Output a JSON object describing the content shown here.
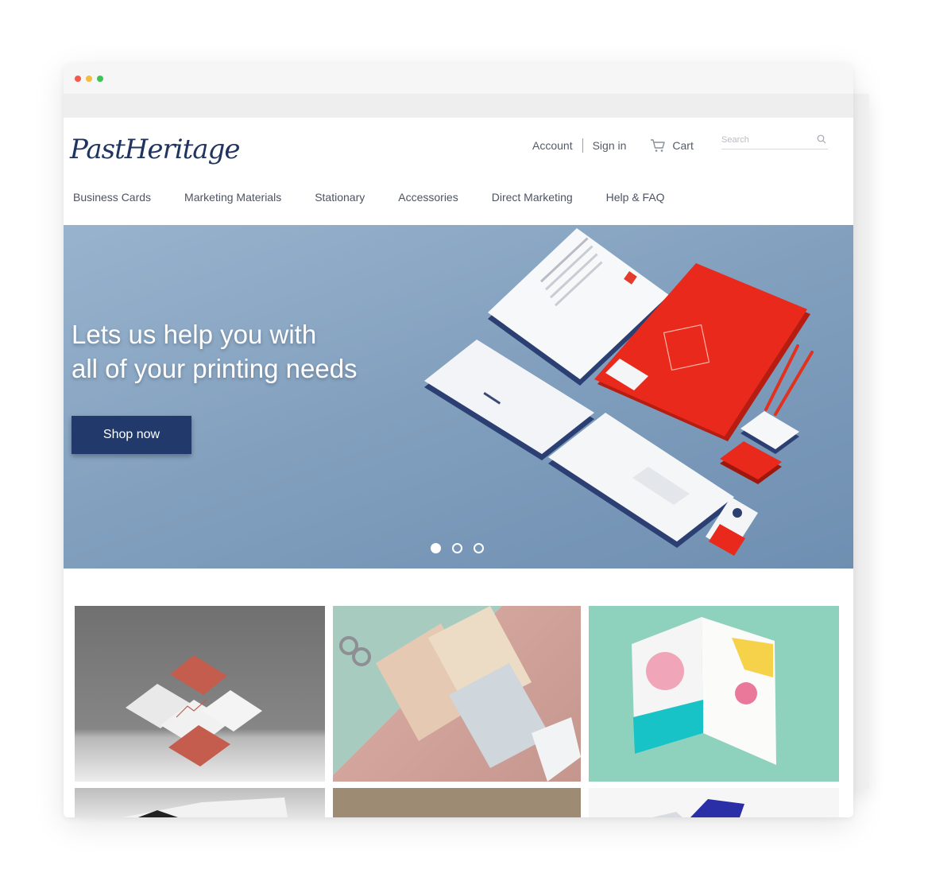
{
  "brand": {
    "logo": "PastHeritage",
    "color": "#21335f"
  },
  "header": {
    "account_label": "Account",
    "signin_label": "Sign in",
    "cart_label": "Cart",
    "search_placeholder": "Search"
  },
  "nav": {
    "items": [
      {
        "label": "Business Cards"
      },
      {
        "label": "Marketing Materials"
      },
      {
        "label": "Stationary"
      },
      {
        "label": "Accessories"
      },
      {
        "label": "Direct Marketing"
      },
      {
        "label": "Help & FAQ"
      }
    ]
  },
  "hero": {
    "title_line1": "Lets us help you with",
    "title_line2": "all of your printing needs",
    "cta_label": "Shop now",
    "button_color": "#213a6b",
    "slides_total": 3,
    "active_slide": 1
  },
  "product_tiles": [
    {
      "image": "business-cards-mockup"
    },
    {
      "image": "desk-calendars-mockup"
    },
    {
      "image": "trifold-brochure-mockup"
    },
    {
      "image": "signage-mockup"
    },
    {
      "image": "kraft-paper-mockup"
    },
    {
      "image": "blue-folder-mockup"
    }
  ]
}
